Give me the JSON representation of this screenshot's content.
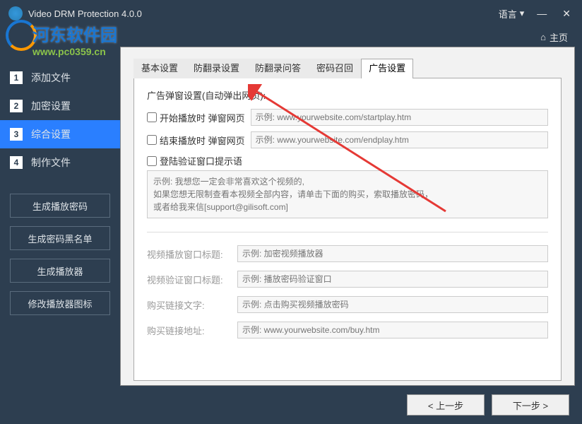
{
  "title": "Video DRM Protection 4.0.0",
  "language_label": "语言",
  "home_label": "主页",
  "watermark": {
    "cn": "河东软件园",
    "url": "www.pc0359.cn"
  },
  "nav": [
    {
      "num": "1",
      "label": "添加文件"
    },
    {
      "num": "2",
      "label": "加密设置"
    },
    {
      "num": "3",
      "label": "综合设置"
    },
    {
      "num": "4",
      "label": "制作文件"
    }
  ],
  "sidebar_buttons": {
    "gen_play_pw": "生成播放密码",
    "gen_blacklist": "生成密码黑名单",
    "gen_player": "生成播放器",
    "mod_icon": "修改播放器图标"
  },
  "tabs": {
    "t1": "基本设置",
    "t2": "防翻录设置",
    "t3": "防翻录问答",
    "t4": "密码召回",
    "t5": "广告设置"
  },
  "section": {
    "popup_title": "广告弹窗设置(自动弹出网页):",
    "start_play": "开始播放时 弹窗网页",
    "start_play_ph": "示例: www.yourwebsite.com/startplay.htm",
    "end_play": "结束播放时 弹窗网页",
    "end_play_ph": "示例: www.yourwebsite.com/endplay.htm",
    "login_prompt": "登陆验证窗口提示语",
    "login_prompt_ph": "示例: 我想您一定会非常喜欢这个视频的,\n如果您想无限制查看本视频全部内容，请单击下面的购买，索取播放密码，\n或者给我来信[support@gilisoft.com]",
    "play_window_title": "视频播放窗口标题:",
    "play_window_title_ph": "示例: 加密视频播放器",
    "verify_window_title": "视频验证窗口标题:",
    "verify_window_title_ph": "示例: 播放密码验证窗口",
    "buy_link_text": "购买链接文字:",
    "buy_link_text_ph": "示例: 点击购买视频播放密码",
    "buy_link_url": "购买链接地址:",
    "buy_link_url_ph": "示例: www.yourwebsite.com/buy.htm"
  },
  "footer": {
    "prev": "< 上一步",
    "next": "下一步 >"
  }
}
